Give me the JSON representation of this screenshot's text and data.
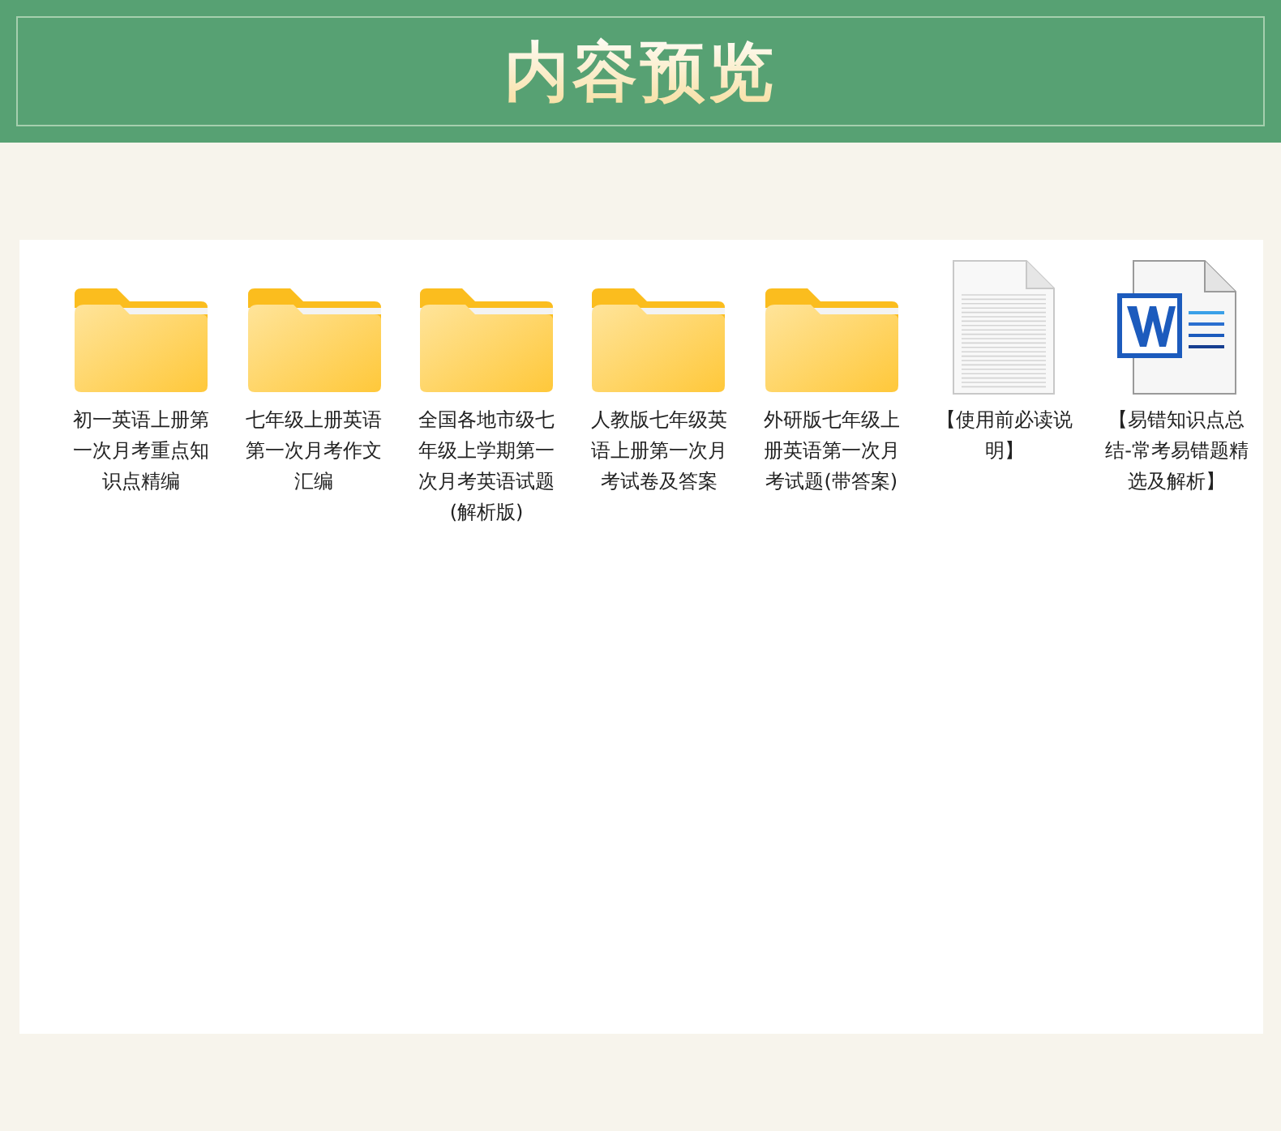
{
  "header": {
    "title": "内容预览"
  },
  "files": [
    {
      "kind": "folder",
      "name": "初一英语上册第一次月考重点知识点精编"
    },
    {
      "kind": "folder",
      "name": "七年级上册英语第一次月考作文汇编"
    },
    {
      "kind": "folder",
      "name": "全国各地市级七年级上学期第一次月考英语试题(解析版)"
    },
    {
      "kind": "folder",
      "name": "人教版七年级英语上册第一次月考试卷及答案"
    },
    {
      "kind": "folder",
      "name": "外研版七年级上册英语第一次月考试题(带答案)"
    },
    {
      "kind": "text",
      "name": "【使用前必读说明】"
    },
    {
      "kind": "word",
      "name": "【易错知识点总结-常考易错题精选及解析】"
    }
  ]
}
